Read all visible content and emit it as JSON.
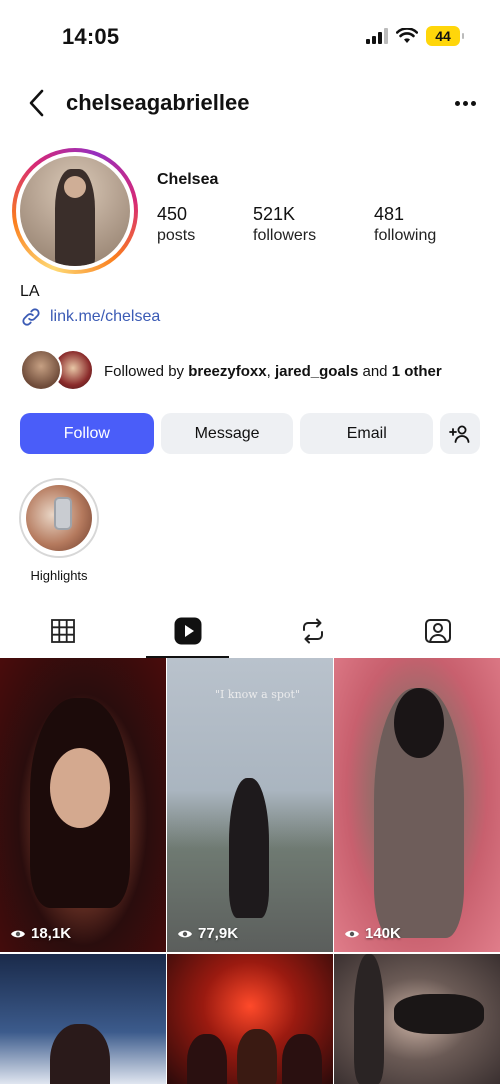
{
  "status_bar": {
    "time": "14:05",
    "battery": "44",
    "icons": [
      "signal-icon",
      "wifi-icon",
      "battery-icon"
    ]
  },
  "header": {
    "username": "chelseagabriellee",
    "back_icon": "chevron-left-icon",
    "more_icon": "more-horizontal-icon"
  },
  "profile": {
    "display_name": "Chelsea",
    "stats": [
      {
        "count": "450",
        "label": "posts"
      },
      {
        "count": "521K",
        "label": "followers"
      },
      {
        "count": "481",
        "label": "following"
      }
    ],
    "location": "LA",
    "link": "link.me/chelsea",
    "followed_by": {
      "prefix": "Followed by ",
      "user1": "breezyfoxx",
      "sep": ", ",
      "user2": "jared_goals",
      "and": " and ",
      "other": "1 other"
    }
  },
  "actions": {
    "follow": "Follow",
    "message": "Message",
    "email": "Email",
    "add_user_icon": "add-user-icon"
  },
  "highlights": [
    {
      "label": "Highlights"
    }
  ],
  "tabs": [
    {
      "name": "grid",
      "icon": "grid-icon",
      "active": false
    },
    {
      "name": "reels",
      "icon": "reels-icon",
      "active": true
    },
    {
      "name": "reposts",
      "icon": "repost-icon",
      "active": false
    },
    {
      "name": "tagged",
      "icon": "tagged-user-icon",
      "active": false
    }
  ],
  "grid": {
    "items": [
      {
        "views": "18,1K"
      },
      {
        "views": "77,9K",
        "caption": "\"I know a spot\""
      },
      {
        "views": "140K"
      },
      {
        "views": ""
      },
      {
        "views": ""
      },
      {
        "views": ""
      }
    ]
  },
  "colors": {
    "accent": "#4a5df9",
    "link": "#3b5bb5",
    "button_bg": "#eef0f3",
    "battery": "#ffd60a"
  }
}
